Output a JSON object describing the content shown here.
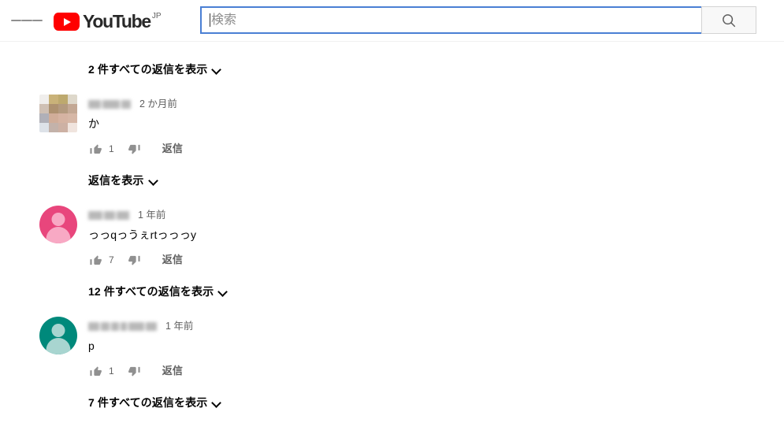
{
  "header": {
    "menu_label": "guide-menu",
    "logo_text": "YouTube",
    "logo_country": "JP",
    "search": {
      "placeholder": "検索",
      "value": "",
      "button_label": "search"
    }
  },
  "comments_section": {
    "top_show_replies": {
      "label": "2 件すべての返信を表示"
    },
    "items": [
      {
        "author_blurred": true,
        "timestamp": "2 か月前",
        "text": "か",
        "like_count": "1",
        "reply_label": "返信",
        "avatar_type": "mosaic-photo",
        "avatar_colors": [
          "#f0eeec",
          "#c9b279",
          "#bda96e",
          "#ded8cb",
          "#cfc0b4",
          "#ad9170",
          "#b39a7f",
          "#c3a894",
          "#b0b0b8",
          "#d0ad99",
          "#d5b3a2",
          "#d6b7a6",
          "#dde2e8",
          "#c3b2aa",
          "#cdb1a4",
          "#f0e4de"
        ],
        "show_replies_label": "返信を表示"
      },
      {
        "author_blurred": true,
        "timestamp": "1 年前",
        "text": "っっqっうぇrtっっっy",
        "like_count": "7",
        "reply_label": "返信",
        "avatar_type": "default-silhouette",
        "avatar_bg": "#e8467c",
        "avatar_fg": "#f8a9c4",
        "show_replies_label": "12 件すべての返信を表示"
      },
      {
        "author_blurred": true,
        "timestamp": "1 年前",
        "text": "p",
        "like_count": "1",
        "reply_label": "返信",
        "avatar_type": "default-silhouette",
        "avatar_bg": "#00897b",
        "avatar_fg": "#a8d5d0",
        "show_replies_label": "7 件すべての返信を表示"
      }
    ]
  },
  "colors": {
    "brand_red": "#ff0000",
    "search_focus_border": "#4a7fd4",
    "text_primary": "#030303",
    "text_secondary": "#606060",
    "page_background": "#ffffff"
  }
}
